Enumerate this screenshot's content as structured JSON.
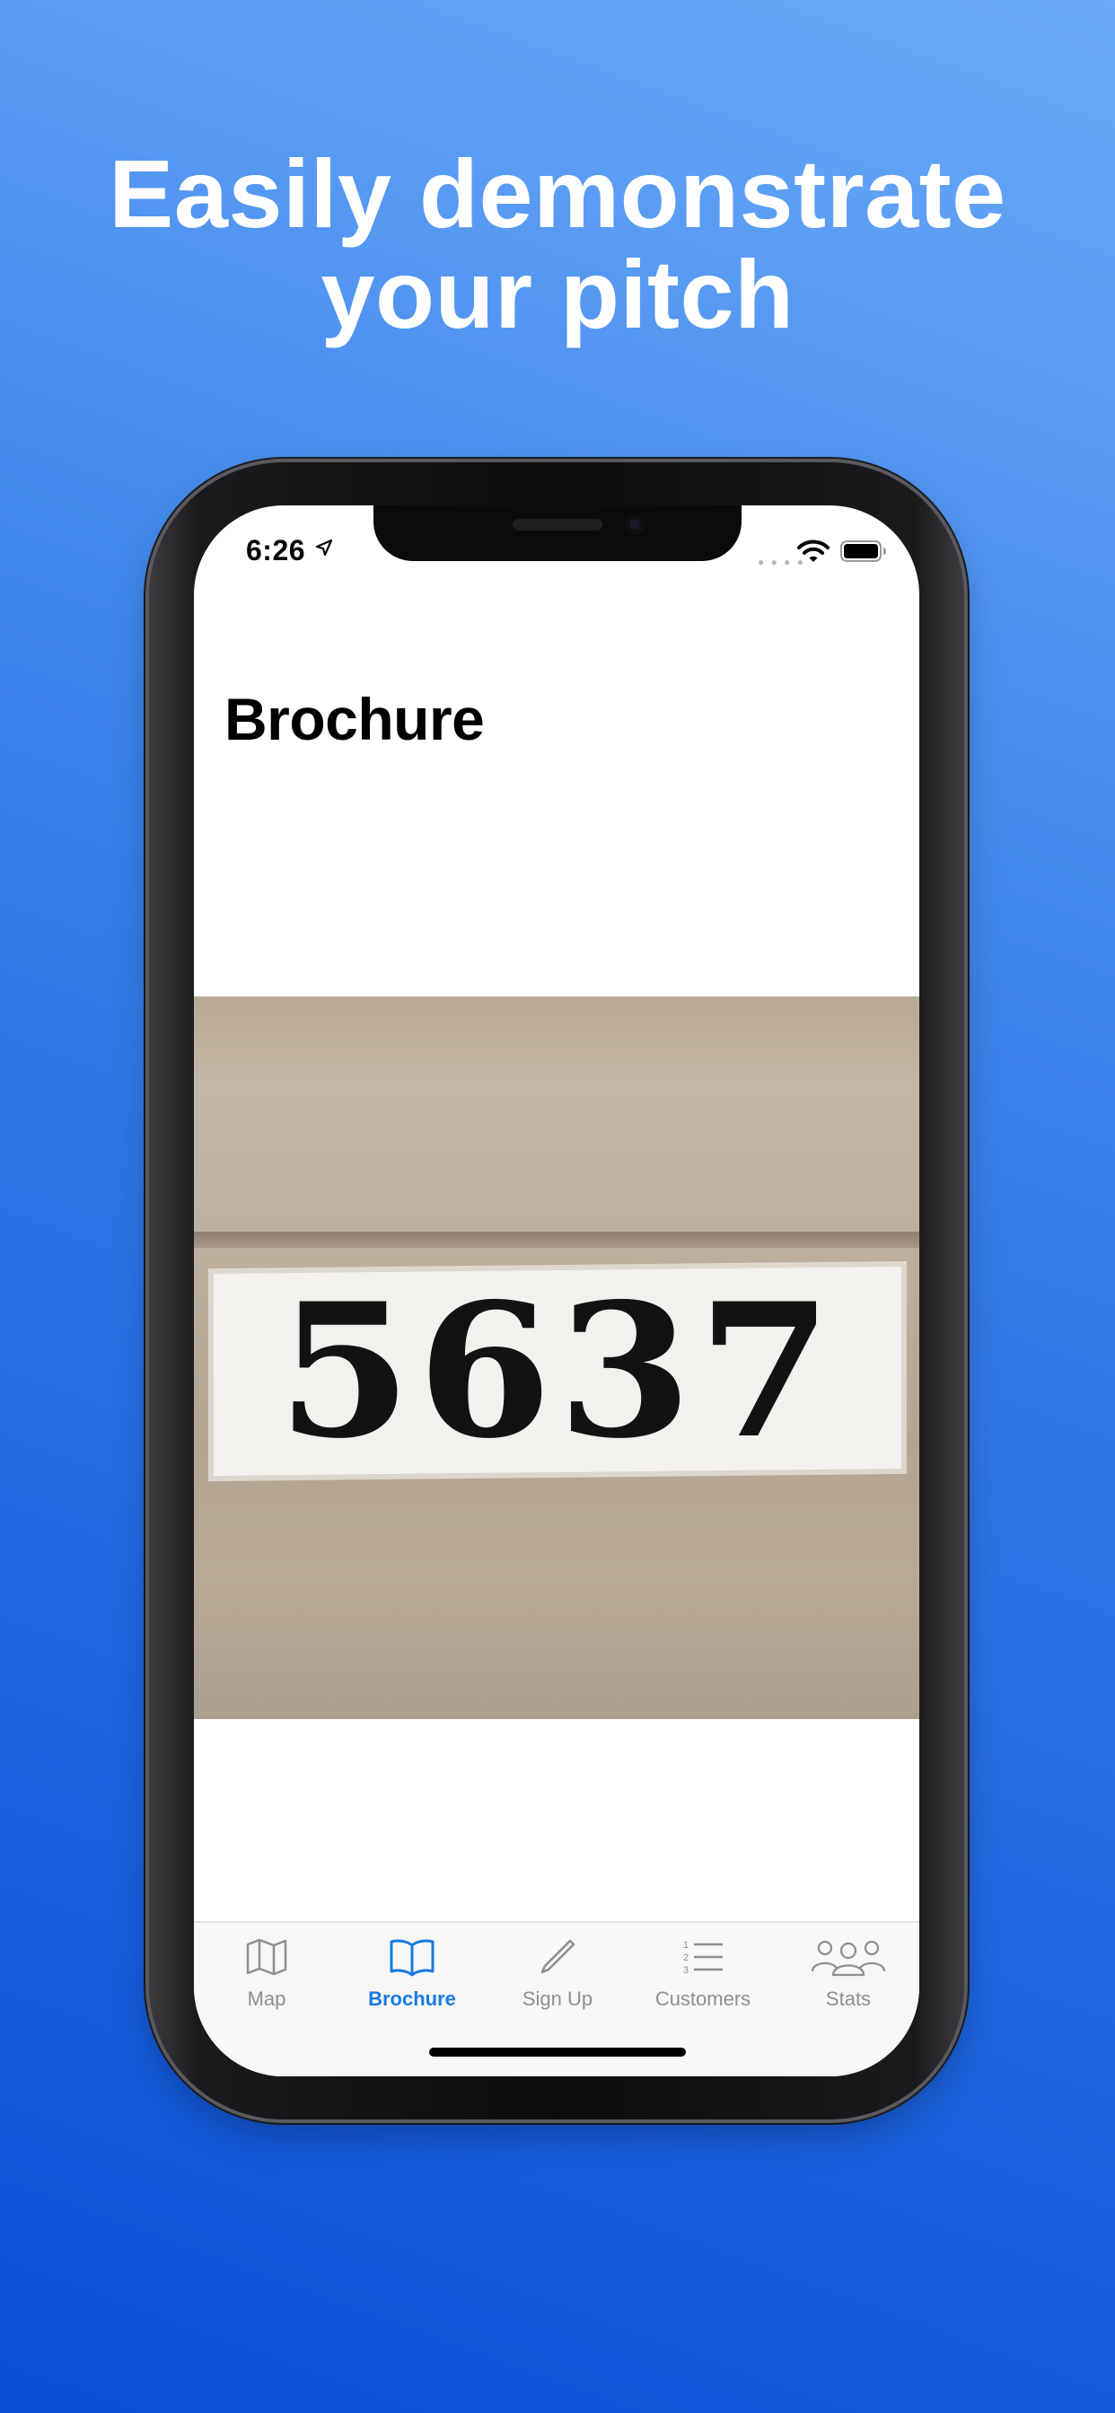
{
  "headline": {
    "line1": "Easily demonstrate",
    "line2": "your pitch"
  },
  "status_bar": {
    "time": "6:26",
    "icons": [
      "location-arrow-icon",
      "wifi-icon",
      "battery-icon"
    ]
  },
  "page": {
    "title": "Brochure"
  },
  "brochure_image": {
    "number_text": "5637"
  },
  "tab_bar": {
    "tabs": [
      {
        "label": "Map",
        "icon": "map-icon",
        "active": false
      },
      {
        "label": "Brochure",
        "icon": "book-icon",
        "active": true
      },
      {
        "label": "Sign Up",
        "icon": "pencil-icon",
        "active": false
      },
      {
        "label": "Customers",
        "icon": "numbered-list-icon",
        "active": false
      },
      {
        "label": "Stats",
        "icon": "people-icon",
        "active": false
      }
    ]
  },
  "colors": {
    "accent": "#1a7ae0",
    "inactive_tab": "#8e8e93",
    "background_top": "#6aaaf8",
    "background_bottom": "#0a4fd4"
  }
}
